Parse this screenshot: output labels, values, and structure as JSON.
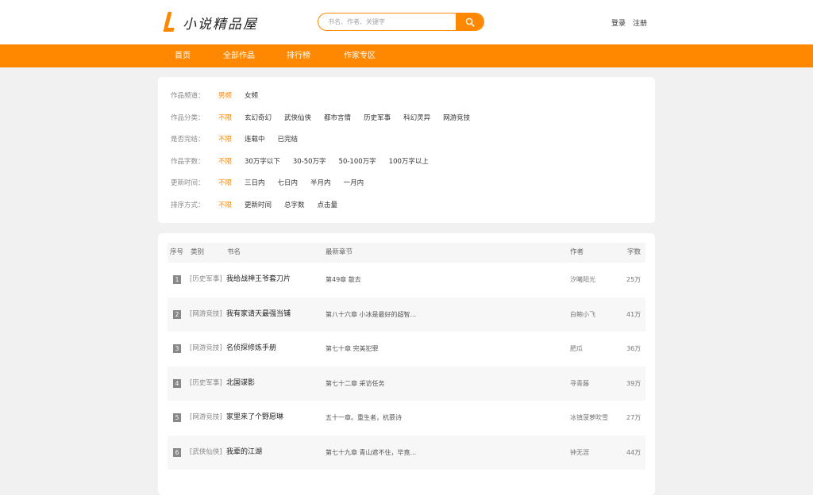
{
  "header": {
    "logo_text": "小说精品屋",
    "search": {
      "placeholder": "书名、作者、关键字"
    },
    "login": "登录",
    "register": "注册"
  },
  "nav": [
    "首页",
    "全部作品",
    "排行榜",
    "作家专区"
  ],
  "filters": [
    {
      "label": "作品频道：",
      "options": [
        "男频",
        "女频"
      ],
      "active": 0
    },
    {
      "label": "作品分类：",
      "options": [
        "不限",
        "玄幻奇幻",
        "武侠仙侠",
        "都市言情",
        "历史军事",
        "科幻灵异",
        "网游竞技"
      ],
      "active": 0
    },
    {
      "label": "是否完结：",
      "options": [
        "不限",
        "连载中",
        "已完结"
      ],
      "active": 0
    },
    {
      "label": "作品字数：",
      "options": [
        "不限",
        "30万字以下",
        "30-50万字",
        "50-100万字",
        "100万字以上"
      ],
      "active": 0
    },
    {
      "label": "更新时间：",
      "options": [
        "不限",
        "三日内",
        "七日内",
        "半月内",
        "一月内"
      ],
      "active": 0
    },
    {
      "label": "排序方式：",
      "options": [
        "不限",
        "更新时间",
        "总字数",
        "点击量"
      ],
      "active": 0
    }
  ],
  "table": {
    "headers": {
      "rank": "序号",
      "category": "类别",
      "title": "书名",
      "chapter": "最新章节",
      "author": "作者",
      "words": "字数"
    },
    "rows": [
      {
        "rank": "1",
        "category": "[历史军事]",
        "title": "我给战神王爷套刀片",
        "chapter": "第49章 散去",
        "author": "汐曦阳光",
        "words": "25万"
      },
      {
        "rank": "2",
        "category": "[网游竞技]",
        "title": "我有家请天最强当铺",
        "chapter": "第八十六章 小冰是最好的超智...",
        "author": "白鲍小飞",
        "words": "41万"
      },
      {
        "rank": "3",
        "category": "[网游竞技]",
        "title": "名侦探修炼手册",
        "chapter": "第七十章 完美犯罪",
        "author": "肥瓜",
        "words": "36万"
      },
      {
        "rank": "4",
        "category": "[历史军事]",
        "title": "北国谍影",
        "chapter": "第七十二章 采访任务",
        "author": "寻青藤",
        "words": "39万"
      },
      {
        "rank": "5",
        "category": "[网游竞技]",
        "title": "家里来了个野愿琳",
        "chapter": "五十一章。重生者，杭慕诗",
        "author": "冰镇菠萝吹雪",
        "words": "27万"
      },
      {
        "rank": "6",
        "category": "[武侠仙侠]",
        "title": "我辈的江湖",
        "chapter": "第七十九章 青山遮不住，毕竟...",
        "author": "钟无涯",
        "words": "44万"
      }
    ]
  },
  "colors": {
    "accent": "#ff8800",
    "page_bg": "#f1f1f1"
  },
  "icons": {
    "search": "search-icon",
    "logo": "logo-mark-icon"
  }
}
